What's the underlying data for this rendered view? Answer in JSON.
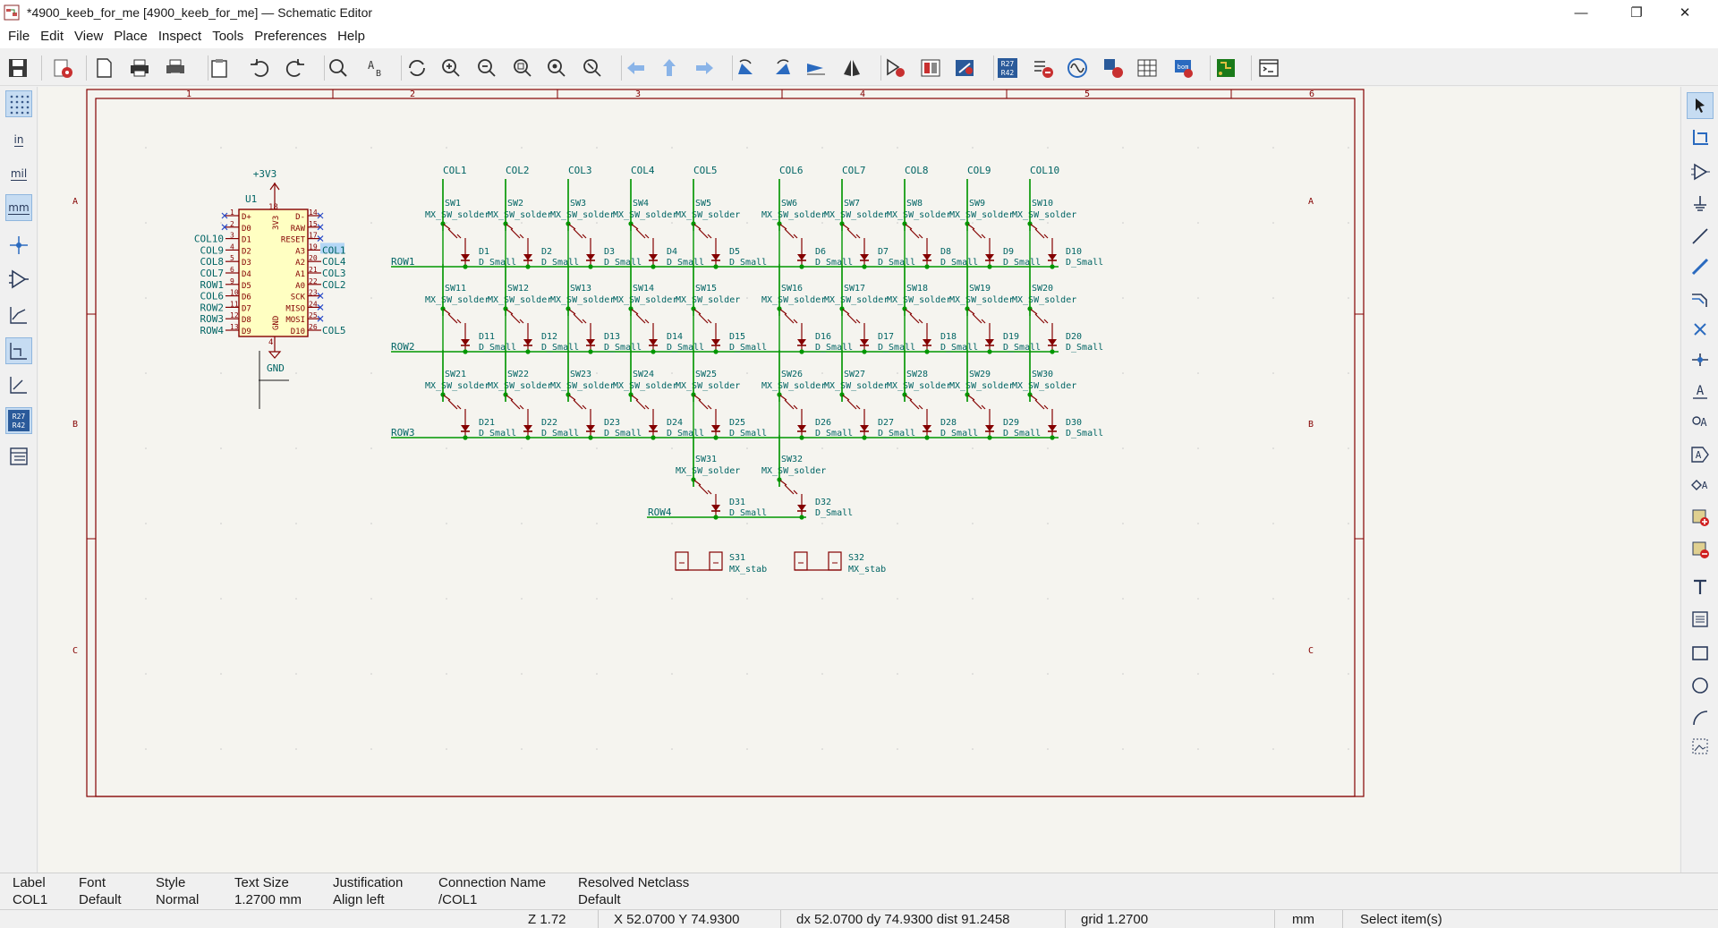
{
  "window": {
    "title": "*4900_keeb_for_me [4900_keeb_for_me] — Schematic Editor",
    "minimize_glyph": "—",
    "maximize_glyph": "❐",
    "close_glyph": "✕"
  },
  "menu": [
    "File",
    "Edit",
    "View",
    "Place",
    "Inspect",
    "Tools",
    "Preferences",
    "Help"
  ],
  "toolbar_icons": [
    "save-icon",
    "schematic-setup-icon",
    "page-settings-icon",
    "print-icon",
    "plot-icon",
    "paste-icon",
    "undo-icon",
    "redo-icon",
    "find-icon",
    "find-replace-icon",
    "refresh-icon",
    "zoom-in-icon",
    "zoom-out-icon",
    "zoom-fit-icon",
    "zoom-objects-icon",
    "zoom-selection-icon",
    "navigate-back-icon",
    "navigate-up-icon",
    "navigate-forward-icon",
    "rotate-ccw-icon",
    "rotate-cw-icon",
    "mirror-vertical-icon",
    "mirror-horizontal-icon",
    "symbol-editor-icon",
    "symbol-browser-icon",
    "annotate-icon",
    "annotate-r-icon",
    "erc-icon",
    "simulator-icon",
    "assign-footprints-icon",
    "edit-fields-icon",
    "bom-icon",
    "pcb-editor-icon",
    "scripting-console-icon"
  ],
  "left_toolbar": {
    "units_in": "in",
    "units_mil": "mil",
    "units_mm": "mm",
    "annotate_label": "R27\nR42"
  },
  "schematic": {
    "sheet_numbers_top": [
      "1",
      "2",
      "3",
      "4",
      "5",
      "6"
    ],
    "sheet_letters": [
      "A",
      "B",
      "C"
    ],
    "mcu": {
      "power_label": "+3V3",
      "gnd_label": "GND",
      "ref": "U1",
      "left_pins": [
        {
          "num": "1",
          "name": "D+",
          "net": ""
        },
        {
          "num": "2",
          "name": "D0",
          "net": ""
        },
        {
          "num": "3",
          "name": "D1",
          "net": "COL10"
        },
        {
          "num": "4",
          "name": "D2",
          "net": "COL9"
        },
        {
          "num": "5",
          "name": "D3",
          "net": "COL8"
        },
        {
          "num": "6",
          "name": "D4",
          "net": "COL7"
        },
        {
          "num": "9",
          "name": "D5",
          "net": "ROW1"
        },
        {
          "num": "10",
          "name": "D6",
          "net": "COL6"
        },
        {
          "num": "11",
          "name": "D7",
          "net": "ROW2"
        },
        {
          "num": "12",
          "name": "D8",
          "net": "ROW3"
        },
        {
          "num": "13",
          "name": "D9",
          "net": "ROW4"
        }
      ],
      "right_pins": [
        {
          "num": "14",
          "name": "D-",
          "net": ""
        },
        {
          "num": "15",
          "name": "RAW",
          "net": ""
        },
        {
          "num": "17",
          "name": "RESET",
          "net": ""
        },
        {
          "num": "19",
          "name": "A3",
          "net": "COL1"
        },
        {
          "num": "20",
          "name": "A2",
          "net": "COL4"
        },
        {
          "num": "21",
          "name": "A1",
          "net": "COL3"
        },
        {
          "num": "22",
          "name": "A0",
          "net": "COL2"
        },
        {
          "num": "23",
          "name": "SCK",
          "net": ""
        },
        {
          "num": "24",
          "name": "MISO",
          "net": ""
        },
        {
          "num": "25",
          "name": "MOSI",
          "net": ""
        },
        {
          "num": "26",
          "name": "D10",
          "net": "COL5"
        }
      ],
      "top_pin": {
        "num": "18",
        "name": "3V3"
      },
      "bottom_pin": {
        "num": "4",
        "name": "GND"
      }
    },
    "columns": [
      "COL1",
      "COL2",
      "COL3",
      "COL4",
      "COL5",
      "COL6",
      "COL7",
      "COL8",
      "COL9",
      "COL10"
    ],
    "rows": [
      "ROW1",
      "ROW2",
      "ROW3",
      "ROW4"
    ],
    "switch_value": "MX_SW_solder",
    "diode_value": "D_Small",
    "stabs": [
      {
        "ref": "S31",
        "value": "MX_stab"
      },
      {
        "ref": "S32",
        "value": "MX_stab"
      }
    ]
  },
  "message_panel": [
    {
      "label": "Label",
      "value": "COL1"
    },
    {
      "label": "Font",
      "value": "Default"
    },
    {
      "label": "Style",
      "value": "Normal"
    },
    {
      "label": "Text Size",
      "value": "1.2700 mm"
    },
    {
      "label": "Justification",
      "value": "Align left"
    },
    {
      "label": "Connection Name",
      "value": "/COL1"
    },
    {
      "label": "Resolved Netclass",
      "value": "Default"
    }
  ],
  "status": {
    "zoom": "Z 1.72",
    "xy": "X 52.0700  Y 74.9300",
    "delta": "dx 52.0700  dy 74.9300  dist 91.2458",
    "grid": "grid 1.2700",
    "units": "mm",
    "mode": "Select item(s)"
  },
  "colors": {
    "sheet_border": "#840000",
    "wire": "#009600",
    "component": "#840000",
    "component_fill": "#ffffc2",
    "text": "#006464",
    "background": "#f5f4ef",
    "selected_label_bg": "#b4d7f6"
  }
}
